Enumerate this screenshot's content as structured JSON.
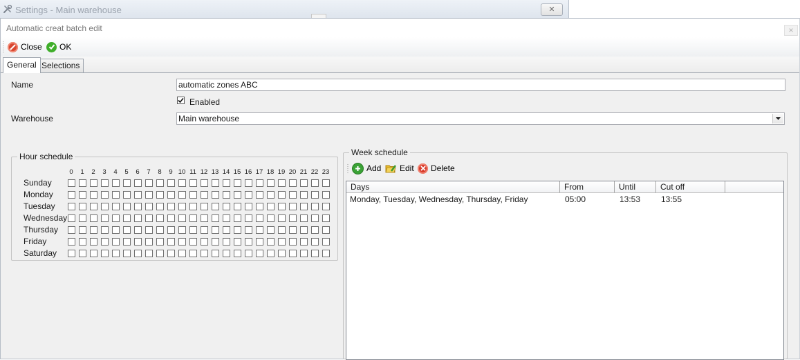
{
  "background_window": {
    "title": "Settings - Main warehouse",
    "close_glyph": "✕"
  },
  "dialog": {
    "title": "Automatic creat batch edit",
    "close_glyph": "✕"
  },
  "toolbar": {
    "close_label": "Close",
    "ok_label": "OK"
  },
  "tabs": [
    {
      "label": "General",
      "active": true
    },
    {
      "label": "Selections",
      "active": false
    }
  ],
  "form": {
    "name_label": "Name",
    "name_value": "automatic zones ABC",
    "enabled_label": "Enabled",
    "enabled_checked": true,
    "warehouse_label": "Warehouse",
    "warehouse_value": "Main warehouse"
  },
  "hour_schedule": {
    "title": "Hour schedule",
    "hours": [
      "0",
      "1",
      "2",
      "3",
      "4",
      "5",
      "6",
      "7",
      "8",
      "9",
      "10",
      "11",
      "12",
      "13",
      "14",
      "15",
      "16",
      "17",
      "18",
      "19",
      "20",
      "21",
      "22",
      "23"
    ],
    "days": [
      "Sunday",
      "Monday",
      "Tuesday",
      "Wednesday",
      "Thursday",
      "Friday",
      "Saturday"
    ]
  },
  "week_schedule": {
    "title": "Week schedule",
    "add_label": "Add",
    "edit_label": "Edit",
    "delete_label": "Delete",
    "columns": [
      "Days",
      "From",
      "Until",
      "Cut off"
    ],
    "rows": [
      {
        "days": "Monday, Tuesday, Wednesday, Thursday, Friday",
        "from": "05:00",
        "until": "13:53",
        "cut_off": "13:55"
      }
    ]
  },
  "icons": {
    "close": "close-circle-icon",
    "ok": "check-circle-icon",
    "add": "plus-circle-icon",
    "edit": "folder-edit-icon",
    "delete": "x-circle-icon",
    "wrench": "wrench-screwdriver-icon"
  },
  "colors": {
    "close_icon": "#d9452f",
    "ok_icon": "#3fae2a",
    "add_icon": "#3aa235",
    "delete_icon": "#d83b2b",
    "edit_icon": "#e7b92b"
  }
}
